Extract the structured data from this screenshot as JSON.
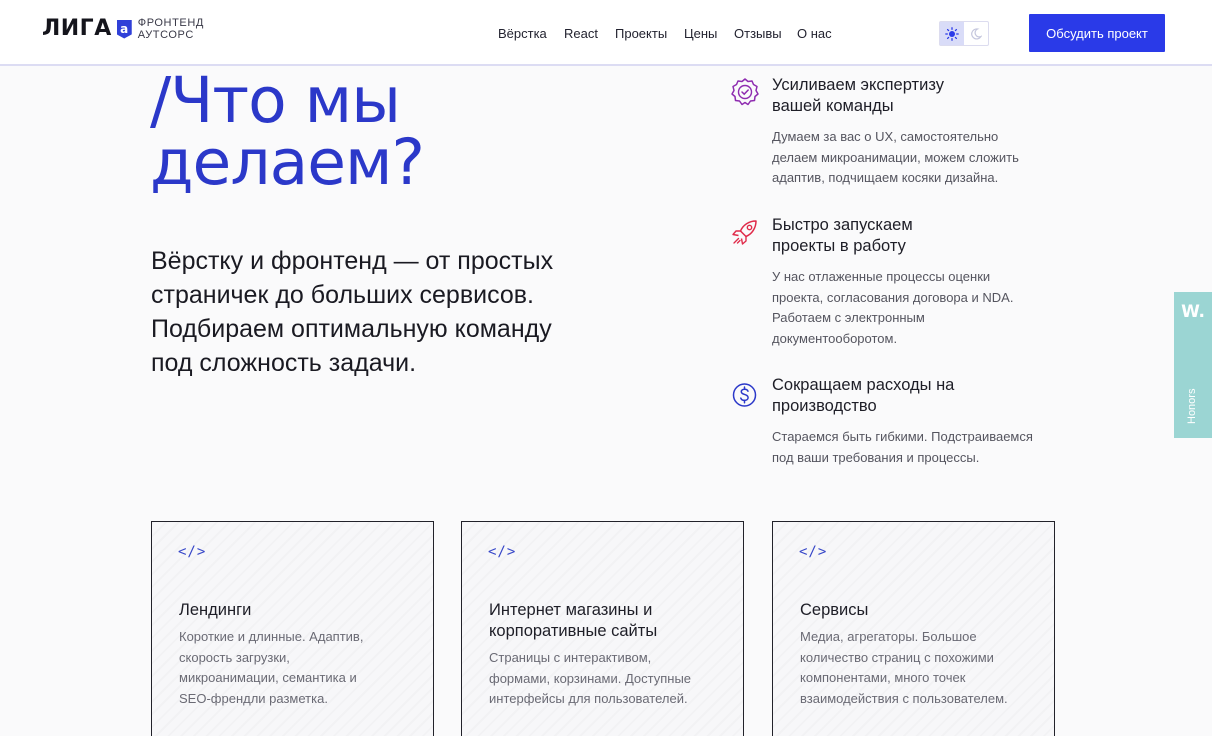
{
  "header": {
    "logo_word": "ЛИГА",
    "logo_badge": "a",
    "logo_sub_line1": "ФРОНТЕНД",
    "logo_sub_line2": "АУТСОРС",
    "nav": [
      {
        "label": "Вёрстка"
      },
      {
        "label": "React"
      },
      {
        "label": "Проекты"
      },
      {
        "label": "Цены"
      },
      {
        "label": "Отзывы"
      },
      {
        "label": "О нас"
      }
    ],
    "cta_label": "Обсудить проект"
  },
  "hero": {
    "title_line1": "/Что мы",
    "title_line2": "делаем?",
    "lead_lines": [
      "Вёрстку и фронтенд — от простых",
      "страничек до больших сервисов.",
      "Подбираем оптимальную команду",
      "под сложность задачи."
    ]
  },
  "features": [
    {
      "icon": "badge-check-icon",
      "title_lines": [
        "Усиливаем экспертизу",
        "вашей команды"
      ],
      "text_lines": [
        "Думаем за вас о UX, самостоятельно",
        "делаем микроанимации, можем сложить",
        "адаптив, подчищаем косяки дизайна."
      ]
    },
    {
      "icon": "rocket-icon",
      "title_lines": [
        "Быстро запускаем",
        "проекты в работу"
      ],
      "text_lines": [
        "У нас отлаженные процессы оценки",
        "проекта, согласования договора и NDA.",
        "Работаем с электронным",
        "документооборотом."
      ]
    },
    {
      "icon": "dollar-coin-icon",
      "title_lines": [
        "Сокращаем расходы на",
        "производство"
      ],
      "text_lines": [
        "Стараемся быть гибкими. Подстраиваемся",
        "под ваши требования и процессы."
      ]
    }
  ],
  "side_tab": {
    "mark": "W.",
    "label": "Honors"
  },
  "cards": [
    {
      "icon_glyph": "</>",
      "title_lines": [
        "Лендинги"
      ],
      "text_lines": [
        "Короткие и длинные. Адаптив,",
        "скорость загрузки,",
        "микроанимации, семантика и",
        "SEO-френдли разметка."
      ]
    },
    {
      "icon_glyph": "</>",
      "title_lines": [
        "Интернет магазины и",
        "корпоративные сайты"
      ],
      "text_lines": [
        "Страницы с интерактивом,",
        "формами, корзинами. Доступные",
        "интерфейсы для пользователей."
      ]
    },
    {
      "icon_glyph": "</>",
      "title_lines": [
        "Сервисы"
      ],
      "text_lines": [
        "Медиа, агрегаторы. Большое",
        "количество страниц с похожими",
        "компонентами, много точек",
        "взаимодействия с пользователем."
      ]
    }
  ],
  "colors": {
    "accent": "#2a3ae8",
    "title_blue": "#2b38c9",
    "icon_purple": "#8e2bb0",
    "icon_red": "#e02b4a",
    "icon_blue": "#2b38c9",
    "side_tab": "#9bd5d3"
  }
}
